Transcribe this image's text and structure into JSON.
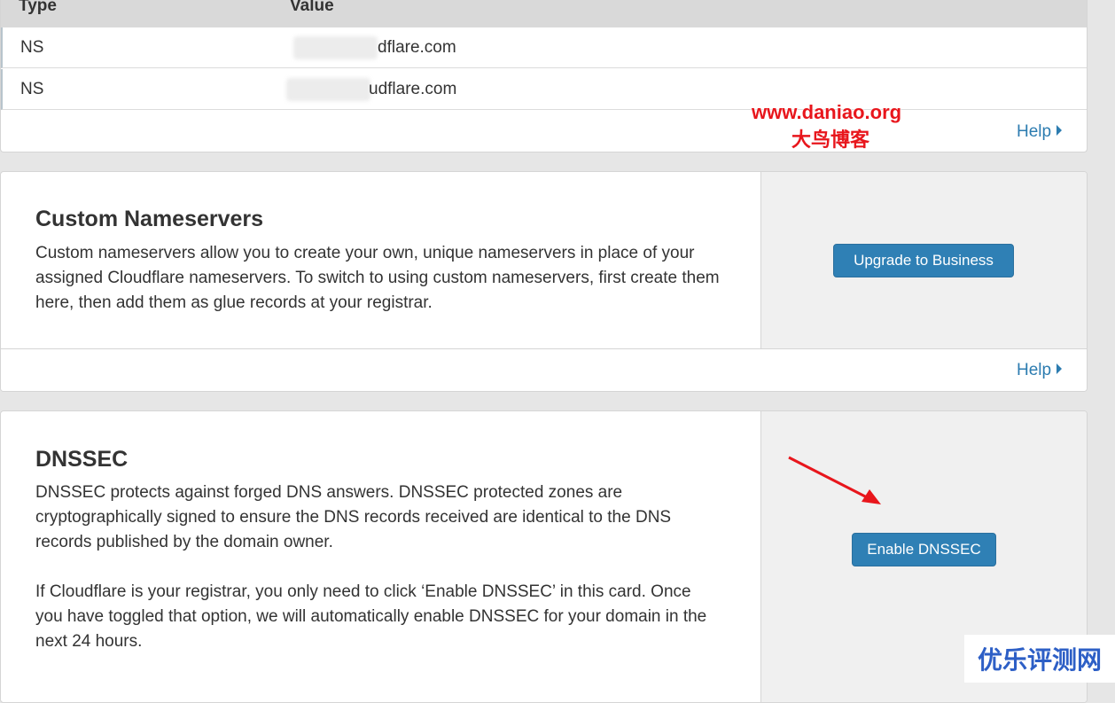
{
  "ns_table": {
    "headers": {
      "type": "Type",
      "value": "Value"
    },
    "rows": [
      {
        "type": "NS",
        "value": "dflare.com"
      },
      {
        "type": "NS",
        "value": "udflare.com"
      }
    ],
    "help_label": "Help"
  },
  "custom_nameservers": {
    "title": "Custom Nameservers",
    "description": "Custom nameservers allow you to create your own, unique nameservers in place of your assigned Cloudflare nameservers. To switch to using custom nameservers, first create them here, then add them as glue records at your registrar.",
    "button_label": "Upgrade to Business",
    "help_label": "Help"
  },
  "dnssec": {
    "title": "DNSSEC",
    "description": "DNSSEC protects against forged DNS answers. DNSSEC protected zones are cryptographically signed to ensure the DNS records received are identical to the DNS records published by the domain owner.",
    "note": "If Cloudflare is your registrar, you only need to click ‘Enable DNSSEC’ in this card. Once you have toggled that option, we will automatically enable DNSSEC for your domain in the next 24 hours.",
    "button_label": "Enable DNSSEC"
  },
  "watermarks": {
    "site_url": "www.daniao.org",
    "site_name": "大鸟博客",
    "corner_label": "优乐评测网"
  },
  "colors": {
    "button": "#2f80b5",
    "link": "#2c7cb0",
    "arrow": "#e8161c"
  }
}
